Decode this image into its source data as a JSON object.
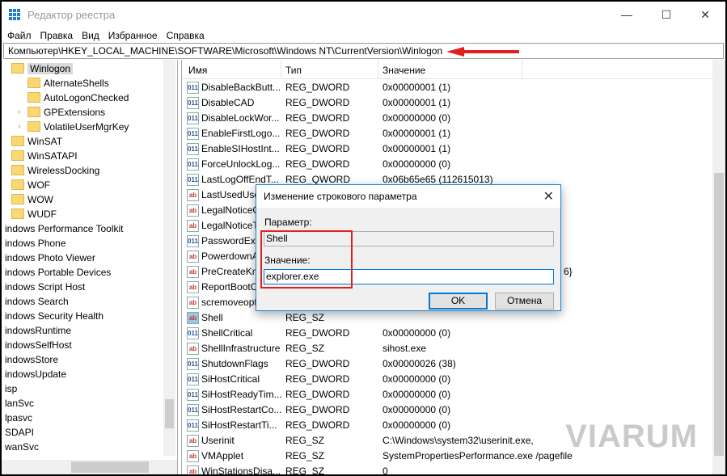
{
  "window": {
    "title": "Редактор реестра",
    "minimize": "—",
    "maximize": "☐",
    "close": "✕"
  },
  "menu": [
    "Файл",
    "Правка",
    "Вид",
    "Избранное",
    "Справка"
  ],
  "address": "Компьютер\\HKEY_LOCAL_MACHINE\\SOFTWARE\\Microsoft\\Windows NT\\CurrentVersion\\Winlogon",
  "tree": {
    "selected": "Winlogon",
    "children": [
      "AlternateShells",
      "AutoLogonChecked",
      "GPExtensions",
      "VolatileUserMgrKey"
    ],
    "siblings": [
      "WinSAT",
      "WinSATAPI",
      "WirelessDocking",
      "WOF",
      "WOW",
      "WUDF"
    ],
    "clipped": [
      "indows Performance Toolkit",
      "indows Phone",
      "indows Photo Viewer",
      "indows Portable Devices",
      "indows Script Host",
      "indows Search",
      "indows Security Health",
      "indowsRuntime",
      "indowsSelfHost",
      "indowsStore",
      "indowsUpdate",
      "isp",
      "lanSvc",
      "lpasvc",
      "SDAPI",
      "wanSvc"
    ]
  },
  "columns": {
    "name": "Имя",
    "type": "Тип",
    "value": "Значение"
  },
  "rows": [
    {
      "name": "DisableBackButt...",
      "type": "REG_DWORD",
      "value": "0x00000001 (1)",
      "kind": "dw"
    },
    {
      "name": "DisableCAD",
      "type": "REG_DWORD",
      "value": "0x00000001 (1)",
      "kind": "dw"
    },
    {
      "name": "DisableLockWor...",
      "type": "REG_DWORD",
      "value": "0x00000000 (0)",
      "kind": "dw"
    },
    {
      "name": "EnableFirstLogo...",
      "type": "REG_DWORD",
      "value": "0x00000001 (1)",
      "kind": "dw"
    },
    {
      "name": "EnableSIHostInt...",
      "type": "REG_DWORD",
      "value": "0x00000001 (1)",
      "kind": "dw"
    },
    {
      "name": "ForceUnlockLog...",
      "type": "REG_DWORD",
      "value": "0x00000000 (0)",
      "kind": "dw"
    },
    {
      "name": "LastLogOffEndT...",
      "type": "REG_QWORD",
      "value": "0x06b65e65 (112615013)",
      "kind": "dw"
    },
    {
      "name": "LastUsedUser",
      "type": "",
      "value": "",
      "kind": "sz"
    },
    {
      "name": "LegalNoticeC",
      "type": "",
      "value": "",
      "kind": "sz"
    },
    {
      "name": "LegalNoticeT",
      "type": "",
      "value": "",
      "kind": "sz"
    },
    {
      "name": "PasswordExp",
      "type": "",
      "value": "",
      "kind": "dw"
    },
    {
      "name": "PowerdownA",
      "type": "",
      "value": "",
      "kind": "sz"
    },
    {
      "name": "PreCreateKno",
      "type": "",
      "value": "6}",
      "kind": "sz"
    },
    {
      "name": "ReportBootO",
      "type": "",
      "value": "",
      "kind": "sz"
    },
    {
      "name": "scremoveopt",
      "type": "",
      "value": "",
      "kind": "sz"
    },
    {
      "name": "Shell",
      "type": "REG_SZ",
      "value": "",
      "kind": "sz"
    },
    {
      "name": "ShellCritical",
      "type": "REG_DWORD",
      "value": "0x00000000 (0)",
      "kind": "dw"
    },
    {
      "name": "ShellInfrastructure",
      "type": "REG_SZ",
      "value": "sihost.exe",
      "kind": "sz"
    },
    {
      "name": "ShutdownFlags",
      "type": "REG_DWORD",
      "value": "0x00000026 (38)",
      "kind": "dw"
    },
    {
      "name": "SiHostCritical",
      "type": "REG_DWORD",
      "value": "0x00000000 (0)",
      "kind": "dw"
    },
    {
      "name": "SiHostReadyTim...",
      "type": "REG_DWORD",
      "value": "0x00000000 (0)",
      "kind": "dw"
    },
    {
      "name": "SiHostRestartCo...",
      "type": "REG_DWORD",
      "value": "0x00000000 (0)",
      "kind": "dw"
    },
    {
      "name": "SiHostRestartTi...",
      "type": "REG_DWORD",
      "value": "0x00000000 (0)",
      "kind": "dw"
    },
    {
      "name": "Userinit",
      "type": "REG_SZ",
      "value": "C:\\Windows\\system32\\userinit.exe,",
      "kind": "sz"
    },
    {
      "name": "VMApplet",
      "type": "REG_SZ",
      "value": "SystemPropertiesPerformance.exe /pagefile",
      "kind": "sz"
    },
    {
      "name": "WinStationsDisa...",
      "type": "REG_SZ",
      "value": "0",
      "kind": "sz"
    }
  ],
  "dialog": {
    "title": "Изменение строкового параметра",
    "param_label": "Параметр:",
    "param_value": "Shell",
    "value_label": "Значение:",
    "value": "explorer.exe",
    "ok": "OK",
    "cancel": "Отмена"
  },
  "watermark": "VIARUM",
  "colors": {
    "accent": "#0078d7",
    "highlight": "#e02020"
  }
}
